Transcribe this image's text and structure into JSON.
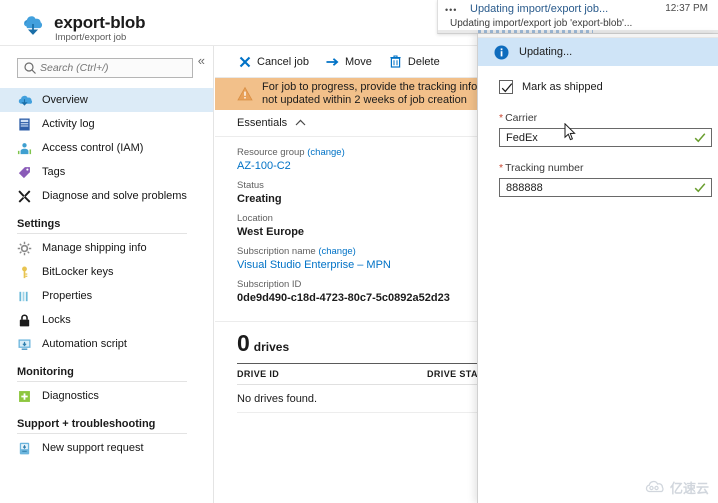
{
  "header": {
    "title": "export-blob",
    "subtitle": "Import/export job",
    "resource_icon": "cloud-import-export-icon",
    "collapse_icon": "chevron-double-left-icon"
  },
  "search": {
    "placeholder": "Search (Ctrl+/)",
    "value": "",
    "icon": "search-icon"
  },
  "sidebar": {
    "items": [
      {
        "label": "Overview",
        "icon": "cloud-import-export-icon",
        "selected": true
      },
      {
        "label": "Activity log",
        "icon": "activity-log-icon",
        "selected": false
      },
      {
        "label": "Access control (IAM)",
        "icon": "access-control-icon",
        "selected": false
      },
      {
        "label": "Tags",
        "icon": "tag-icon",
        "selected": false
      },
      {
        "label": "Diagnose and solve problems",
        "icon": "wrench-screwdriver-icon",
        "selected": false
      }
    ],
    "groups": [
      {
        "title": "Settings",
        "items": [
          {
            "label": "Manage shipping info",
            "icon": "gear-icon"
          },
          {
            "label": "BitLocker keys",
            "icon": "key-icon"
          },
          {
            "label": "Properties",
            "icon": "properties-bars-icon"
          },
          {
            "label": "Locks",
            "icon": "lock-icon"
          },
          {
            "label": "Automation script",
            "icon": "automation-script-icon"
          }
        ]
      },
      {
        "title": "Monitoring",
        "items": [
          {
            "label": "Diagnostics",
            "icon": "diagnostics-icon"
          }
        ]
      },
      {
        "title": "Support + troubleshooting",
        "items": [
          {
            "label": "New support request",
            "icon": "support-request-icon"
          }
        ]
      }
    ]
  },
  "command_bar": {
    "commands": [
      {
        "label": "Cancel job",
        "icon": "x-cancel-icon"
      },
      {
        "label": "Move",
        "icon": "arrow-right-move-icon"
      },
      {
        "label": "Delete",
        "icon": "trash-delete-icon"
      }
    ]
  },
  "warning": {
    "icon": "warning-triangle-icon",
    "line1": "For job to progress, provide the tracking informati",
    "line2": "not updated within 2 weeks of job creation",
    "color": "#f2c08a"
  },
  "essentials": {
    "label": "Essentials",
    "chevron": "chevron-up-icon",
    "properties": [
      {
        "key": "Resource group",
        "change": "(change)",
        "value": "AZ-100-C2",
        "style": "link"
      },
      {
        "key": "Status",
        "change": "",
        "value": "Creating",
        "style": "bold"
      },
      {
        "key": "Location",
        "change": "",
        "value": "West Europe",
        "style": "bold"
      },
      {
        "key": "Subscription name",
        "change": "(change)",
        "value": "Visual Studio Enterprise – MPN",
        "style": "link"
      },
      {
        "key": "Subscription ID",
        "change": "",
        "value": "0de9d490-c18d-4723-80c7-5c0892a52d23",
        "style": "bold"
      }
    ]
  },
  "drives": {
    "count": "0",
    "word": "drives",
    "columns": [
      "DRIVE ID",
      "DRIVE STATE"
    ],
    "empty_message": "No drives found."
  },
  "toast": {
    "dots": "•••",
    "title": "Updating import/export job...",
    "time": "12:37 PM",
    "subtitle": "Updating import/export job 'export-blob'...",
    "title_color": "#2a5b8c"
  },
  "panel": {
    "status": {
      "icon": "info-circle-icon",
      "text": "Updating...",
      "background": "#cfe4f7"
    },
    "mark_as_shipped": {
      "label": "Mark as shipped",
      "checked": true,
      "icon": "checkmark-icon"
    },
    "fields": [
      {
        "label": "Carrier",
        "required": "*",
        "value": "FedEx",
        "placeholder": "",
        "valid_icon": "green-check-icon",
        "name": "carrier-field"
      },
      {
        "label": "Tracking number",
        "required": "*",
        "value": "888888",
        "placeholder": "",
        "valid_icon": "green-check-icon",
        "name": "tracking-number-field"
      }
    ]
  },
  "watermark": {
    "text": "亿速云",
    "icon": "cloud-watermark-icon"
  }
}
